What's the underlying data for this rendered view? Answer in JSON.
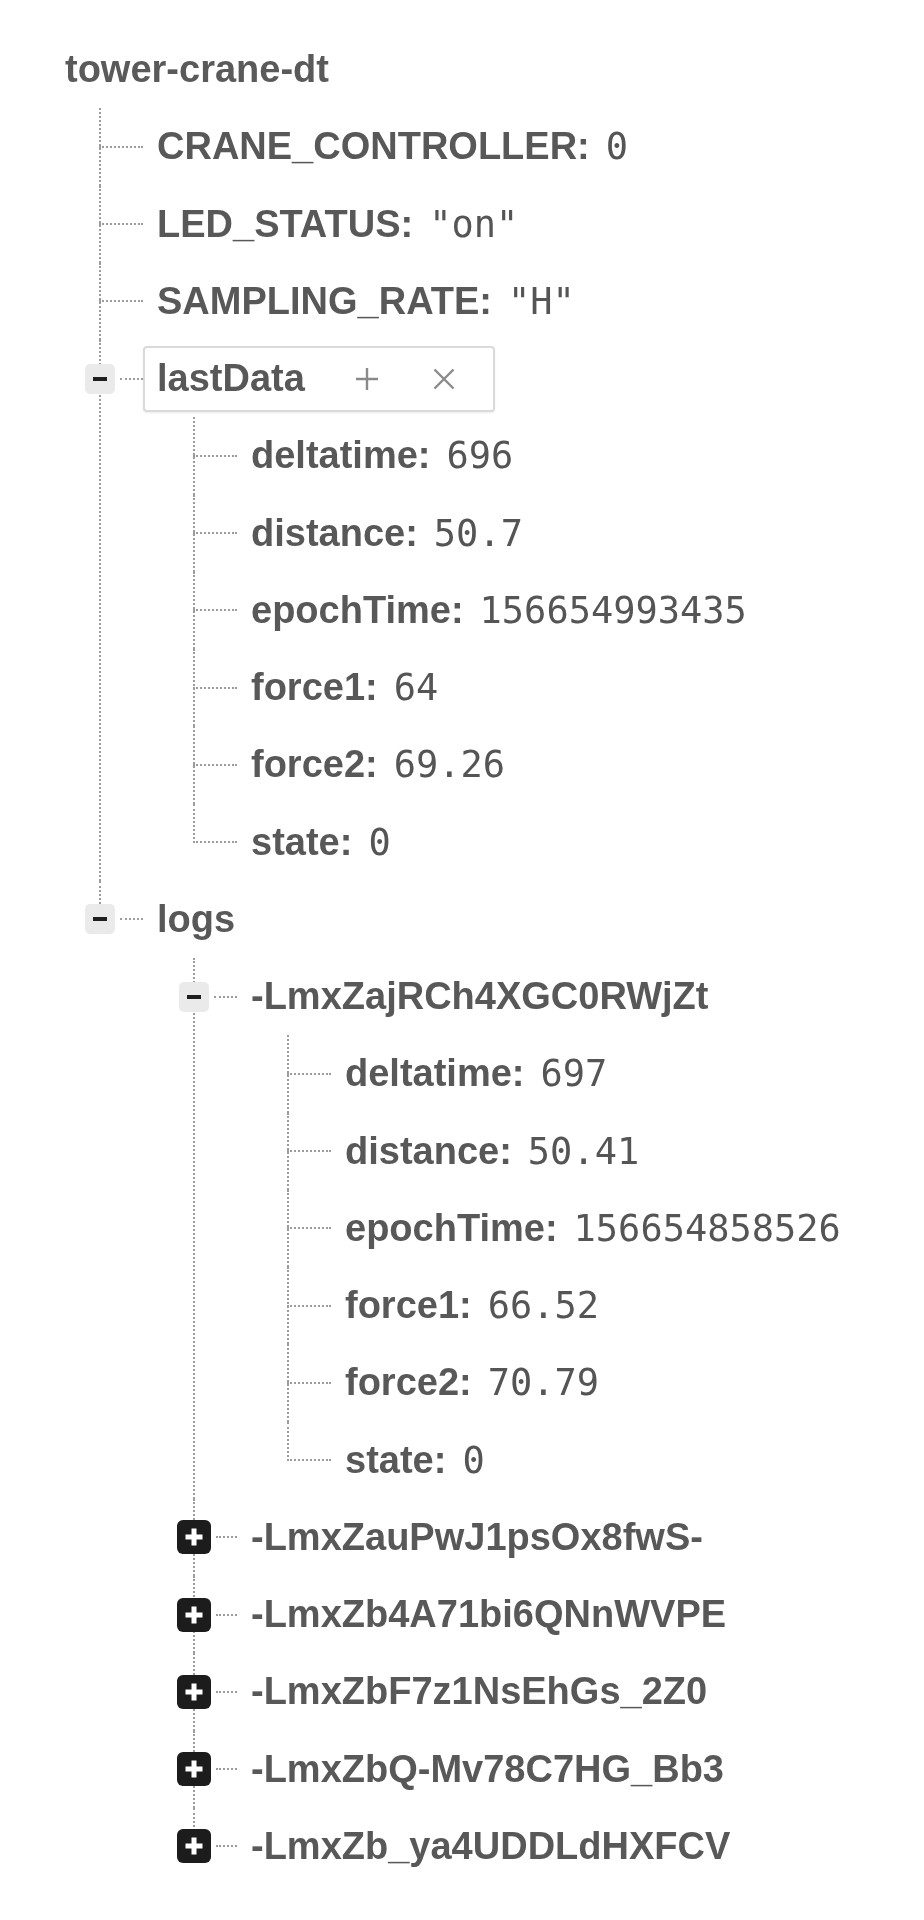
{
  "tree": {
    "title": "tower-crane-dt",
    "children": [
      {
        "kind": "field",
        "key": "CRANE_CONTROLLER:",
        "value": "0",
        "selected": false
      },
      {
        "kind": "field",
        "key": "LED_STATUS:",
        "value": "\"on\"",
        "selected": false
      },
      {
        "kind": "field",
        "key": "SAMPLING_RATE:",
        "value": "\"H\"",
        "selected": false
      },
      {
        "kind": "branch",
        "key": "lastData",
        "expanded": true,
        "selected": true,
        "children": [
          {
            "kind": "field",
            "key": "deltatime:",
            "value": "696",
            "selected": false
          },
          {
            "kind": "field",
            "key": "distance:",
            "value": "50.7",
            "selected": false
          },
          {
            "kind": "field",
            "key": "epochTime:",
            "value": "156654993435",
            "selected": false
          },
          {
            "kind": "field",
            "key": "force1:",
            "value": "64",
            "selected": false
          },
          {
            "kind": "field",
            "key": "force2:",
            "value": "69.26",
            "selected": false
          },
          {
            "kind": "field",
            "key": "state:",
            "value": "0",
            "selected": false
          }
        ]
      },
      {
        "kind": "branch",
        "key": "logs",
        "expanded": true,
        "selected": false,
        "children": [
          {
            "kind": "branch",
            "key": "-LmxZajRCh4XGC0RWjZt",
            "expanded": true,
            "selected": false,
            "children": [
              {
                "kind": "field",
                "key": "deltatime:",
                "value": "697",
                "selected": false
              },
              {
                "kind": "field",
                "key": "distance:",
                "value": "50.41",
                "selected": false
              },
              {
                "kind": "field",
                "key": "epochTime:",
                "value": "156654858526",
                "selected": false
              },
              {
                "kind": "field",
                "key": "force1:",
                "value": "66.52",
                "selected": false
              },
              {
                "kind": "field",
                "key": "force2:",
                "value": "70.79",
                "selected": false
              },
              {
                "kind": "field",
                "key": "state:",
                "value": "0",
                "selected": false
              }
            ]
          },
          {
            "kind": "branch",
            "key": "-LmxZauPwJ1psOx8fwS-",
            "expanded": false,
            "selected": false
          },
          {
            "kind": "branch",
            "key": "-LmxZb4A71bi6QNnWVPE",
            "expanded": false,
            "selected": false
          },
          {
            "kind": "branch",
            "key": "-LmxZbF7z1NsEhGs_2Z0",
            "expanded": false,
            "selected": false
          },
          {
            "kind": "branch",
            "key": "-LmxZbQ-Mv78C7HG_Bb3",
            "expanded": false,
            "selected": false
          },
          {
            "kind": "branch",
            "key": "-LmxZb_ya4UDDLdHXFCV",
            "expanded": false,
            "selected": false
          }
        ]
      }
    ]
  }
}
